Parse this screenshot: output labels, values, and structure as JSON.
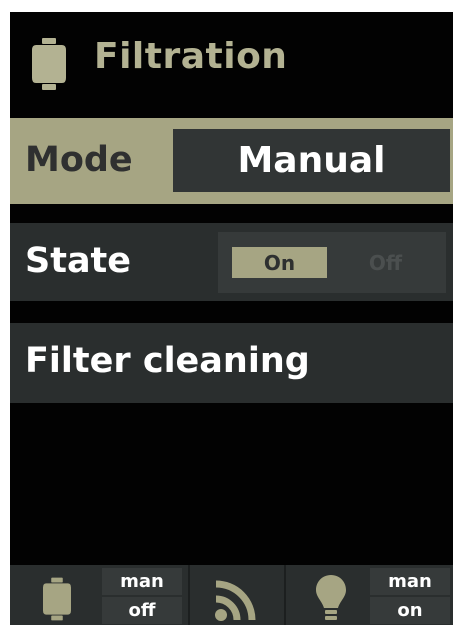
{
  "header": {
    "title": "Filtration",
    "icon": "filter-canister-icon"
  },
  "mode": {
    "label": "Mode",
    "value": "Manual"
  },
  "state": {
    "label": "State",
    "on_label": "On",
    "off_label": "Off",
    "selected": "On"
  },
  "menu": {
    "filter_cleaning_label": "Filter cleaning"
  },
  "status_bar": {
    "filtration": {
      "icon": "filter-canister-icon",
      "mode": "man",
      "state": "off"
    },
    "signal": {
      "icon": "wireless-signal-icon"
    },
    "light": {
      "icon": "lightbulb-icon",
      "mode": "man",
      "state": "on"
    }
  },
  "colors": {
    "accent": "#a6a583",
    "title_text": "#b3b292",
    "background": "#020202",
    "row_background": "#2a2e2e",
    "value_box": "#313535"
  }
}
